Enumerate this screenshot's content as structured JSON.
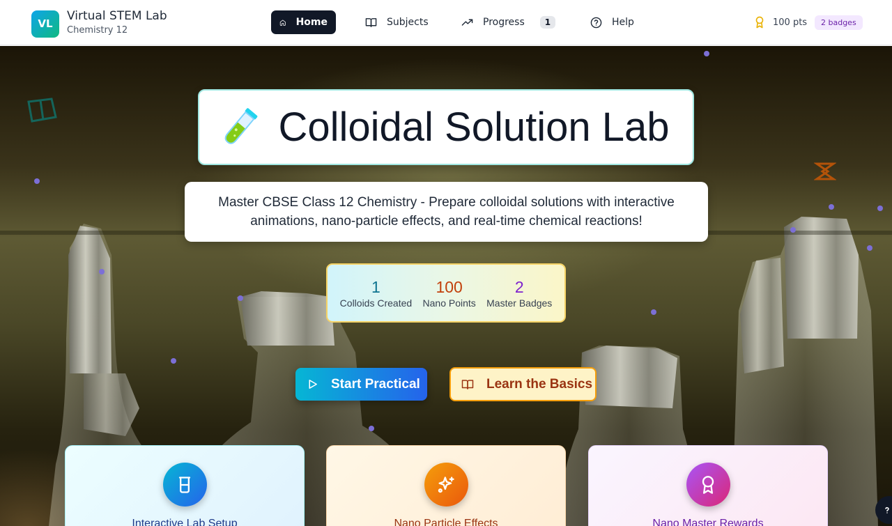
{
  "brand": {
    "logo": "VL",
    "title": "Virtual STEM Lab",
    "subtitle": "Chemistry 12"
  },
  "nav": {
    "home": {
      "label": "Home",
      "icon": "home-icon"
    },
    "subjects": {
      "label": "Subjects",
      "icon": "book-icon"
    },
    "progress": {
      "label": "Progress",
      "icon": "trending-up-icon",
      "badge": "1"
    },
    "help": {
      "label": "Help",
      "icon": "help-circle-icon"
    }
  },
  "user": {
    "points": "100 pts",
    "badges": "2 badges"
  },
  "hero": {
    "title": "Colloidal Solution Lab",
    "title_icon": "test-tube-icon",
    "subtitle": "Master CBSE Class 12 Chemistry - Prepare colloidal solutions with interactive animations, nano-particle effects, and real-time chemical reactions!"
  },
  "stats": [
    {
      "value": "1",
      "label": "Colloids Created",
      "color": "#0e7490"
    },
    {
      "value": "100",
      "label": "Nano Points",
      "color": "#c2410c"
    },
    {
      "value": "2",
      "label": "Master Badges",
      "color": "#7e22ce"
    }
  ],
  "actions": {
    "start": "Start Practical",
    "learn": "Learn the Basics"
  },
  "features": [
    {
      "title": "Interactive Lab Setup",
      "icon": "beaker-icon"
    },
    {
      "title": "Nano Particle Effects",
      "icon": "sparkles-icon"
    },
    {
      "title": "Nano Master Rewards",
      "icon": "award-icon"
    }
  ],
  "colors": {
    "accent": "#111827",
    "primary_gradient": [
      "#06b6d4",
      "#2563eb"
    ],
    "secondary": "#f59e0b"
  }
}
